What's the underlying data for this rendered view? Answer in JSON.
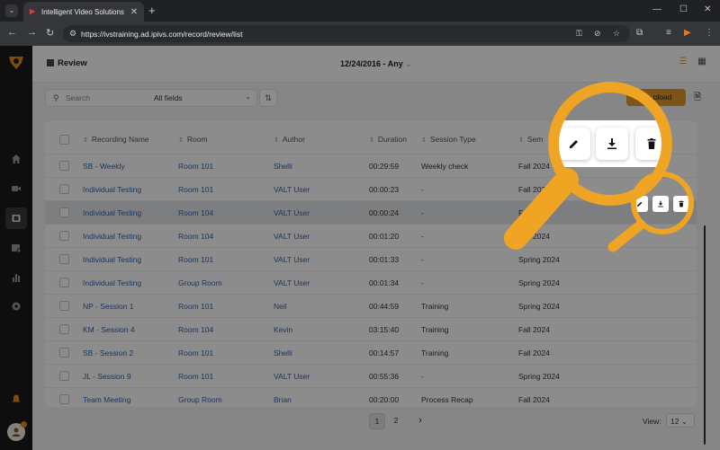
{
  "browser": {
    "tab_title": "Intelligent Video Solutions",
    "url": "https://ivstraining.ad.ipivs.com/record/review/list",
    "new_tab": "+",
    "close": "✕"
  },
  "page": {
    "title": "Review",
    "date_filter": "12/24/2016 - Any"
  },
  "toolbar": {
    "search_placeholder": "Search",
    "field_select": "All fields",
    "upload_label": "Upload",
    "upload_visible": "pload"
  },
  "table": {
    "columns": [
      "Recording Name",
      "Room",
      "Author",
      "Duration",
      "Session Type",
      "Semester"
    ],
    "columns_visible": [
      "Recording Name",
      "Room",
      "Author",
      "Duration",
      "Session Type",
      "Sem"
    ],
    "rows": [
      {
        "name": "SB - Weekly",
        "room": "Room 101",
        "author": "Shelli",
        "duration": "00:29:59",
        "type": "Weekly check",
        "semester": "Fall 2024"
      },
      {
        "name": "Individual Testing",
        "room": "Room 101",
        "author": "VALT User",
        "duration": "00:00:23",
        "type": "-",
        "semester": "Fall 2024"
      },
      {
        "name": "Individual Testing",
        "room": "Room 104",
        "author": "VALT User",
        "duration": "00:00:24",
        "type": "-",
        "semester": "Fall 2024"
      },
      {
        "name": "Individual Testing",
        "room": "Room 104",
        "author": "VALT User",
        "duration": "00:01:20",
        "type": "-",
        "semester": "Fall 2024"
      },
      {
        "name": "Individual Testing",
        "room": "Room 101",
        "author": "VALT User",
        "duration": "00:01:33",
        "type": "-",
        "semester": "Spring 2024"
      },
      {
        "name": "Individual Testing",
        "room": "Group Room",
        "author": "VALT User",
        "duration": "00:01:34",
        "type": "-",
        "semester": "Spring 2024"
      },
      {
        "name": "NP - Session 1",
        "room": "Room 101",
        "author": "Neil",
        "duration": "00:44:59",
        "type": "Training",
        "semester": "Spring 2024"
      },
      {
        "name": "KM - Session 4",
        "room": "Room 104",
        "author": "Kevin",
        "duration": "03:15:40",
        "type": "Training",
        "semester": "Fall 2024"
      },
      {
        "name": "SB - Session 2",
        "room": "Room 101",
        "author": "Shelli",
        "duration": "00:14:57",
        "type": "Training",
        "semester": "Fall 2024"
      },
      {
        "name": "JL - Session 9",
        "room": "Room 101",
        "author": "VALT User",
        "duration": "00:55:36",
        "type": "-",
        "semester": "Spring 2024"
      },
      {
        "name": "Team Meeting",
        "room": "Group Room",
        "author": "Brian",
        "duration": "00:20:00",
        "type": "Process Recap",
        "semester": "Fall 2024"
      }
    ]
  },
  "pagination": {
    "pages": [
      "1",
      "2"
    ],
    "next": "›",
    "view_label": "View:",
    "view_value": "12"
  },
  "row_actions": [
    "edit-icon",
    "download-icon",
    "delete-icon"
  ],
  "colors": {
    "accent": "#e39a2a",
    "magnifier": "#f0a423",
    "link": "#2b63b5"
  }
}
